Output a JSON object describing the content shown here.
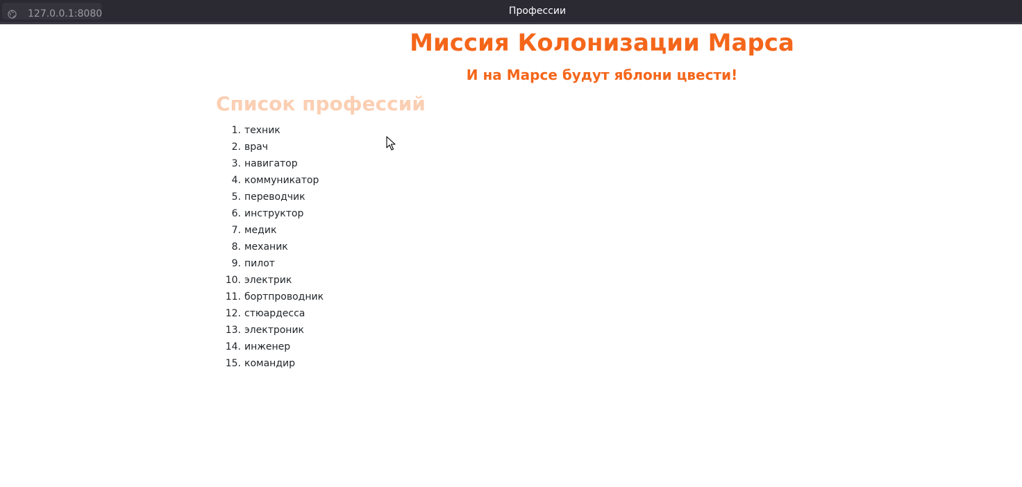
{
  "browser": {
    "url": "127.0.0.1:8080",
    "tab_title": "Профессии"
  },
  "page": {
    "title": "Миссия Колонизации Марса",
    "subtitle": "И на Марсе будут яблони цвести!",
    "list_heading": "Список профессий",
    "professions": [
      {
        "num": "1.",
        "name": "техник"
      },
      {
        "num": "2.",
        "name": "врач"
      },
      {
        "num": "3.",
        "name": "навигатор"
      },
      {
        "num": "4.",
        "name": "коммуникатор"
      },
      {
        "num": "5.",
        "name": "переводчик"
      },
      {
        "num": "6.",
        "name": "инструктор"
      },
      {
        "num": "7.",
        "name": "медик"
      },
      {
        "num": "8.",
        "name": "механик"
      },
      {
        "num": "9.",
        "name": "пилот"
      },
      {
        "num": "10.",
        "name": "электрик"
      },
      {
        "num": "11.",
        "name": "бортпроводник"
      },
      {
        "num": "12.",
        "name": "стюардесса"
      },
      {
        "num": "13.",
        "name": "электроник"
      },
      {
        "num": "14.",
        "name": "инженер"
      },
      {
        "num": "15.",
        "name": "командир"
      }
    ]
  },
  "colors": {
    "titlebar_bg": "#2b2a33",
    "accent_orange": "#f4661a",
    "heading_faded": "#fbcfb3",
    "text": "#212529"
  },
  "icons": {
    "site_icon": "globe-icon",
    "pointer": "cursor-icon"
  }
}
